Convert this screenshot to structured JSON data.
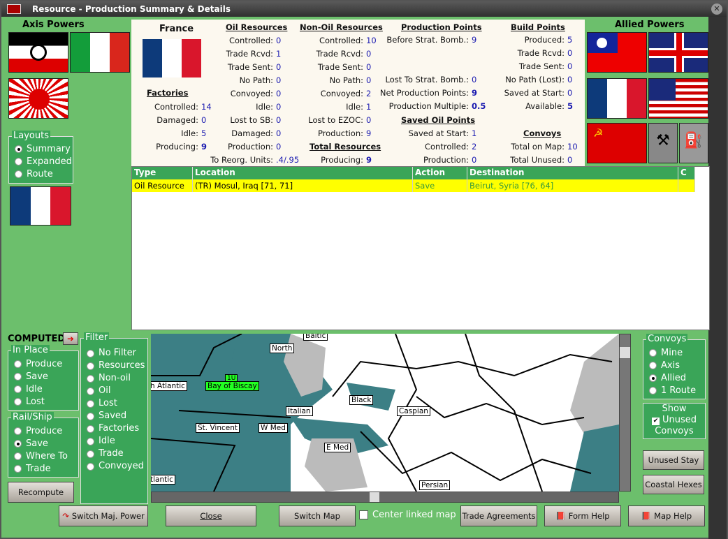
{
  "window": {
    "title": "Resource - Production Summary & Details",
    "close": "✕"
  },
  "axis": {
    "title": "Axis Powers"
  },
  "allied": {
    "title": "Allied Powers"
  },
  "layouts": {
    "title": "Layouts",
    "options": [
      "Summary",
      "Expanded",
      "Route"
    ],
    "selected": 0
  },
  "info": {
    "country": "France",
    "factories": {
      "title": "Factories",
      "rows": [
        [
          "Controlled:",
          "14"
        ],
        [
          "Damaged:",
          "0"
        ],
        [
          "Idle:",
          "5"
        ],
        [
          "Producing:",
          "9"
        ]
      ]
    },
    "oil": {
      "title": "Oil Resources",
      "rows": [
        [
          "Controlled:",
          "0"
        ],
        [
          "Trade Rcvd:",
          "1"
        ],
        [
          "Trade Sent:",
          "0"
        ],
        [
          "No Path:",
          "0"
        ],
        [
          "Convoyed:",
          "0"
        ],
        [
          "Idle:",
          "0"
        ],
        [
          "Lost to SB:",
          "0"
        ],
        [
          "Damaged:",
          "0"
        ],
        [
          "Production:",
          "0"
        ],
        [
          "To Reorg. Units:",
          ".4/.95"
        ]
      ]
    },
    "nonoil": {
      "title": "Non-Oil Resources",
      "rows": [
        [
          "Controlled:",
          "10"
        ],
        [
          "Trade Rcvd:",
          "0"
        ],
        [
          "Trade Sent:",
          "0"
        ],
        [
          "No Path:",
          "0"
        ],
        [
          "Convoyed:",
          "2"
        ],
        [
          "Idle:",
          "1"
        ],
        [
          "Lost to EZOC:",
          "0"
        ],
        [
          "Production:",
          "9"
        ]
      ]
    },
    "total": {
      "title": "Total Resources",
      "rows": [
        [
          "Producing:",
          "9"
        ]
      ]
    },
    "pp": {
      "title": "Production Points",
      "rows": [
        [
          "Before Strat. Bomb.:",
          "9"
        ],
        [
          "Lost To Strat. Bomb.:",
          "0"
        ],
        [
          "Net Production Points:",
          "9"
        ],
        [
          "Production Multiple:",
          "0.5"
        ]
      ]
    },
    "savedoil": {
      "title": "Saved Oil Points",
      "rows": [
        [
          "Saved at Start:",
          "1"
        ],
        [
          "Controlled:",
          "2"
        ],
        [
          "Production:",
          "0"
        ]
      ]
    },
    "bp": {
      "title": "Build Points",
      "rows": [
        [
          "Produced:",
          "5"
        ],
        [
          "Trade Rcvd:",
          "0"
        ],
        [
          "Trade Sent:",
          "0"
        ],
        [
          "No Path (Lost):",
          "0"
        ],
        [
          "Saved at Start:",
          "0"
        ],
        [
          "Available:",
          "5"
        ]
      ]
    },
    "convoys": {
      "title": "Convoys",
      "rows": [
        [
          "Total on Map:",
          "10"
        ],
        [
          "Total Unused:",
          "0"
        ]
      ]
    }
  },
  "table": {
    "headers": [
      "Type",
      "Location",
      "Action",
      "Destination",
      "C"
    ],
    "rows": [
      [
        "Oil Resource",
        "(TR) Mosul, Iraq [71, 71]",
        "Save",
        "Beirut, Syria [76, 64]",
        ""
      ]
    ]
  },
  "computed": {
    "label": "COMPUTED"
  },
  "inplace": {
    "title": "In Place",
    "options": [
      "Produce",
      "Save",
      "Idle",
      "Lost"
    ],
    "selected": -1
  },
  "railship": {
    "title": "Rail/Ship",
    "options": [
      "Produce",
      "Save",
      "Where To",
      "Trade"
    ],
    "selected": 1
  },
  "filter": {
    "title": "Filter",
    "options": [
      "No Filter",
      "Resources",
      "Non-oil",
      "Oil",
      "Lost",
      "Saved",
      "Factories",
      "Idle",
      "Trade",
      "Convoyed"
    ],
    "selected": -1
  },
  "convoysPanel": {
    "title": "Convoys",
    "options": [
      "Mine",
      "Axis",
      "Allied",
      "1 Route"
    ],
    "selected": 2
  },
  "showUnused": {
    "label1": "Show",
    "label2": "Unused",
    "label3": "Convoys",
    "checked": true
  },
  "map": {
    "labels": [
      "Baltic",
      "North",
      "1U",
      "Bay of Biscay",
      "h Atlantic",
      "Black",
      "Italian",
      "Caspian",
      "St. Vincent",
      "W Med",
      "E Med",
      "tlantic",
      "Persian"
    ]
  },
  "buttons": {
    "recompute": "Recompute",
    "switch_power": "Switch Maj. Power",
    "close": "Close",
    "switch_map": "Switch Map",
    "center_linked": "Center linked map",
    "trade": "Trade Agreements",
    "form_help": "Form Help",
    "map_help": "Map Help",
    "unused_stay": "Unused Stay",
    "coastal": "Coastal Hexes"
  }
}
